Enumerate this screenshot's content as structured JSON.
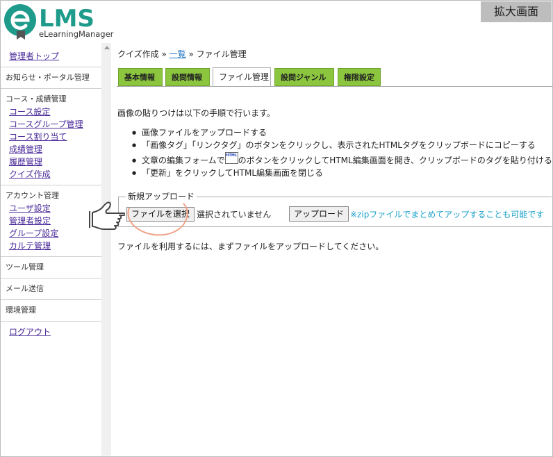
{
  "header": {
    "logo_text": "LMS",
    "logo_subtext": "eLearningManager",
    "zoom_label": "拡大画面"
  },
  "sidebar": {
    "top_link": "管理者トップ",
    "notice": "お知らせ・ポータル管理",
    "course_section": {
      "title": "コース・成績管理",
      "items": [
        "コース設定",
        "コースグループ管理",
        "コース割り当て",
        "成績管理",
        "履歴管理",
        "クイズ作成"
      ]
    },
    "account_section": {
      "title": "アカウント管理",
      "items": [
        "ユーザ設定",
        "管理者設定",
        "グループ設定",
        "カルテ管理"
      ]
    },
    "tool": "ツール管理",
    "mail": "メール送信",
    "env": "環境管理",
    "logout": "ログアウト"
  },
  "breadcrumb": {
    "first": "クイズ作成",
    "sep1": " » ",
    "link": "一覧",
    "sep2": " » ",
    "current": "ファイル管理"
  },
  "tabs": [
    "基本情報",
    "設問情報",
    "ファイル管理",
    "設問ジャンル",
    "権限設定"
  ],
  "intro": "画像の貼りつけは以下の手順で行います。",
  "steps": {
    "s1": "画像ファイルをアップロードする",
    "s2": "「画像タグ」「リンクタグ」のボタンをクリックし、表示されたHTMLタグをクリップボードにコピーする",
    "s3a": "文章の編集フォームで",
    "s3b": "のボタンをクリックしてHTML編集画面を開き、クリップボードのタグを貼り付ける",
    "s4": "「更新」をクリックしてHTML編集画面を閉じる"
  },
  "html_icon_label": "HTML",
  "upload": {
    "legend": "新規アップロード",
    "choose_file": "ファイルを選択",
    "no_file": "選択されていません",
    "upload_button": "アップロード",
    "zip_note": "※zipファイルでまとめてアップすることも可能です"
  },
  "footer_message": "ファイルを利用するには、まずファイルをアップロードしてください。",
  "colors": {
    "tab_green": "#8cc63f",
    "logo_teal": "#1e9b8a",
    "link_purple": "#4a2a9a",
    "note_blue": "#1aa0c8",
    "highlight_ring": "#f0a184"
  }
}
